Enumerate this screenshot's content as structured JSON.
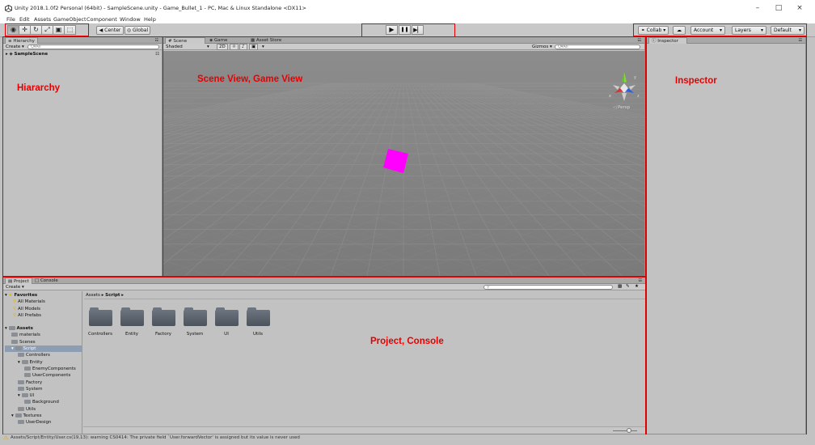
{
  "window": {
    "title": "Unity 2018.1.0f2 Personal (64bit) - SampleScene.unity - Game_Bullet_1 - PC, Mac & Linux Standalone <DX11>",
    "minimize": "–",
    "maximize": "□",
    "close": "×"
  },
  "menu": [
    "File",
    "Edit",
    "Assets",
    "GameObject",
    "Component",
    "Window",
    "Help"
  ],
  "toolbar": {
    "tools": [
      "◉",
      "✛",
      "↻",
      "⤢",
      "▣",
      "⬚"
    ],
    "pivot": "◀ Center",
    "space": "◎ Global",
    "play": "▶",
    "pause": "❚❚",
    "step": "▶▏",
    "collab": "⚭ Collab ▾",
    "cloud": "☁",
    "account": "Account",
    "layers": "Layers",
    "layout": "Default",
    "dropdown_arrow": "▾"
  },
  "hierarchy": {
    "tab": "≡ Hierarchy",
    "create": "Create ▾",
    "search_placeholder": "Q▾All",
    "scene": "SampleScene",
    "annotation": "Hiararchy"
  },
  "scene": {
    "tabs": [
      "# Scene",
      "◈ Game",
      "▦ Asset Store"
    ],
    "shading": "Shaded",
    "mode2d": "2D",
    "gizmos": "Gizmos ▾",
    "search_placeholder": "Q▾All",
    "persp": "◁ Persp",
    "annotation": "Scene View, Game View",
    "cube_color": "#ff00ff"
  },
  "inspector": {
    "tab": "ⓘ Inspector",
    "annotation": "Inspector"
  },
  "project": {
    "tabs": [
      "▤ Project",
      "□ Console"
    ],
    "create": "Create ▾",
    "breadcrumb": [
      "Assets",
      "Script"
    ],
    "favorites": {
      "label": "Favorites",
      "items": [
        "All Materials",
        "All Models",
        "All Prefabs"
      ]
    },
    "assets_label": "Assets",
    "tree": [
      {
        "label": "materials",
        "indent": 1
      },
      {
        "label": "Scenes",
        "indent": 1
      },
      {
        "label": "Script",
        "indent": 1,
        "selected": true,
        "open": true
      },
      {
        "label": "Controllers",
        "indent": 2
      },
      {
        "label": "Entity",
        "indent": 2,
        "open": true
      },
      {
        "label": "EnemyComponents",
        "indent": 3
      },
      {
        "label": "UserComponents",
        "indent": 3
      },
      {
        "label": "Factory",
        "indent": 2
      },
      {
        "label": "System",
        "indent": 2
      },
      {
        "label": "UI",
        "indent": 2,
        "open": true
      },
      {
        "label": "Background",
        "indent": 3
      },
      {
        "label": "Utils",
        "indent": 2
      },
      {
        "label": "Textures",
        "indent": 1,
        "open": true
      },
      {
        "label": "UserDesign",
        "indent": 2
      }
    ],
    "folders": [
      "Controllers",
      "Entity",
      "Factory",
      "System",
      "UI",
      "Utils"
    ],
    "annotation": "Project, Console"
  },
  "status": {
    "message": "Assets/Script/Entity/User.cs(19,13): warning CS0414: The private field `User.forwardVector' is assigned but its value is never used"
  },
  "colors": {
    "annotation_red": "#e80000",
    "panel_bg": "#c2c2c2"
  }
}
